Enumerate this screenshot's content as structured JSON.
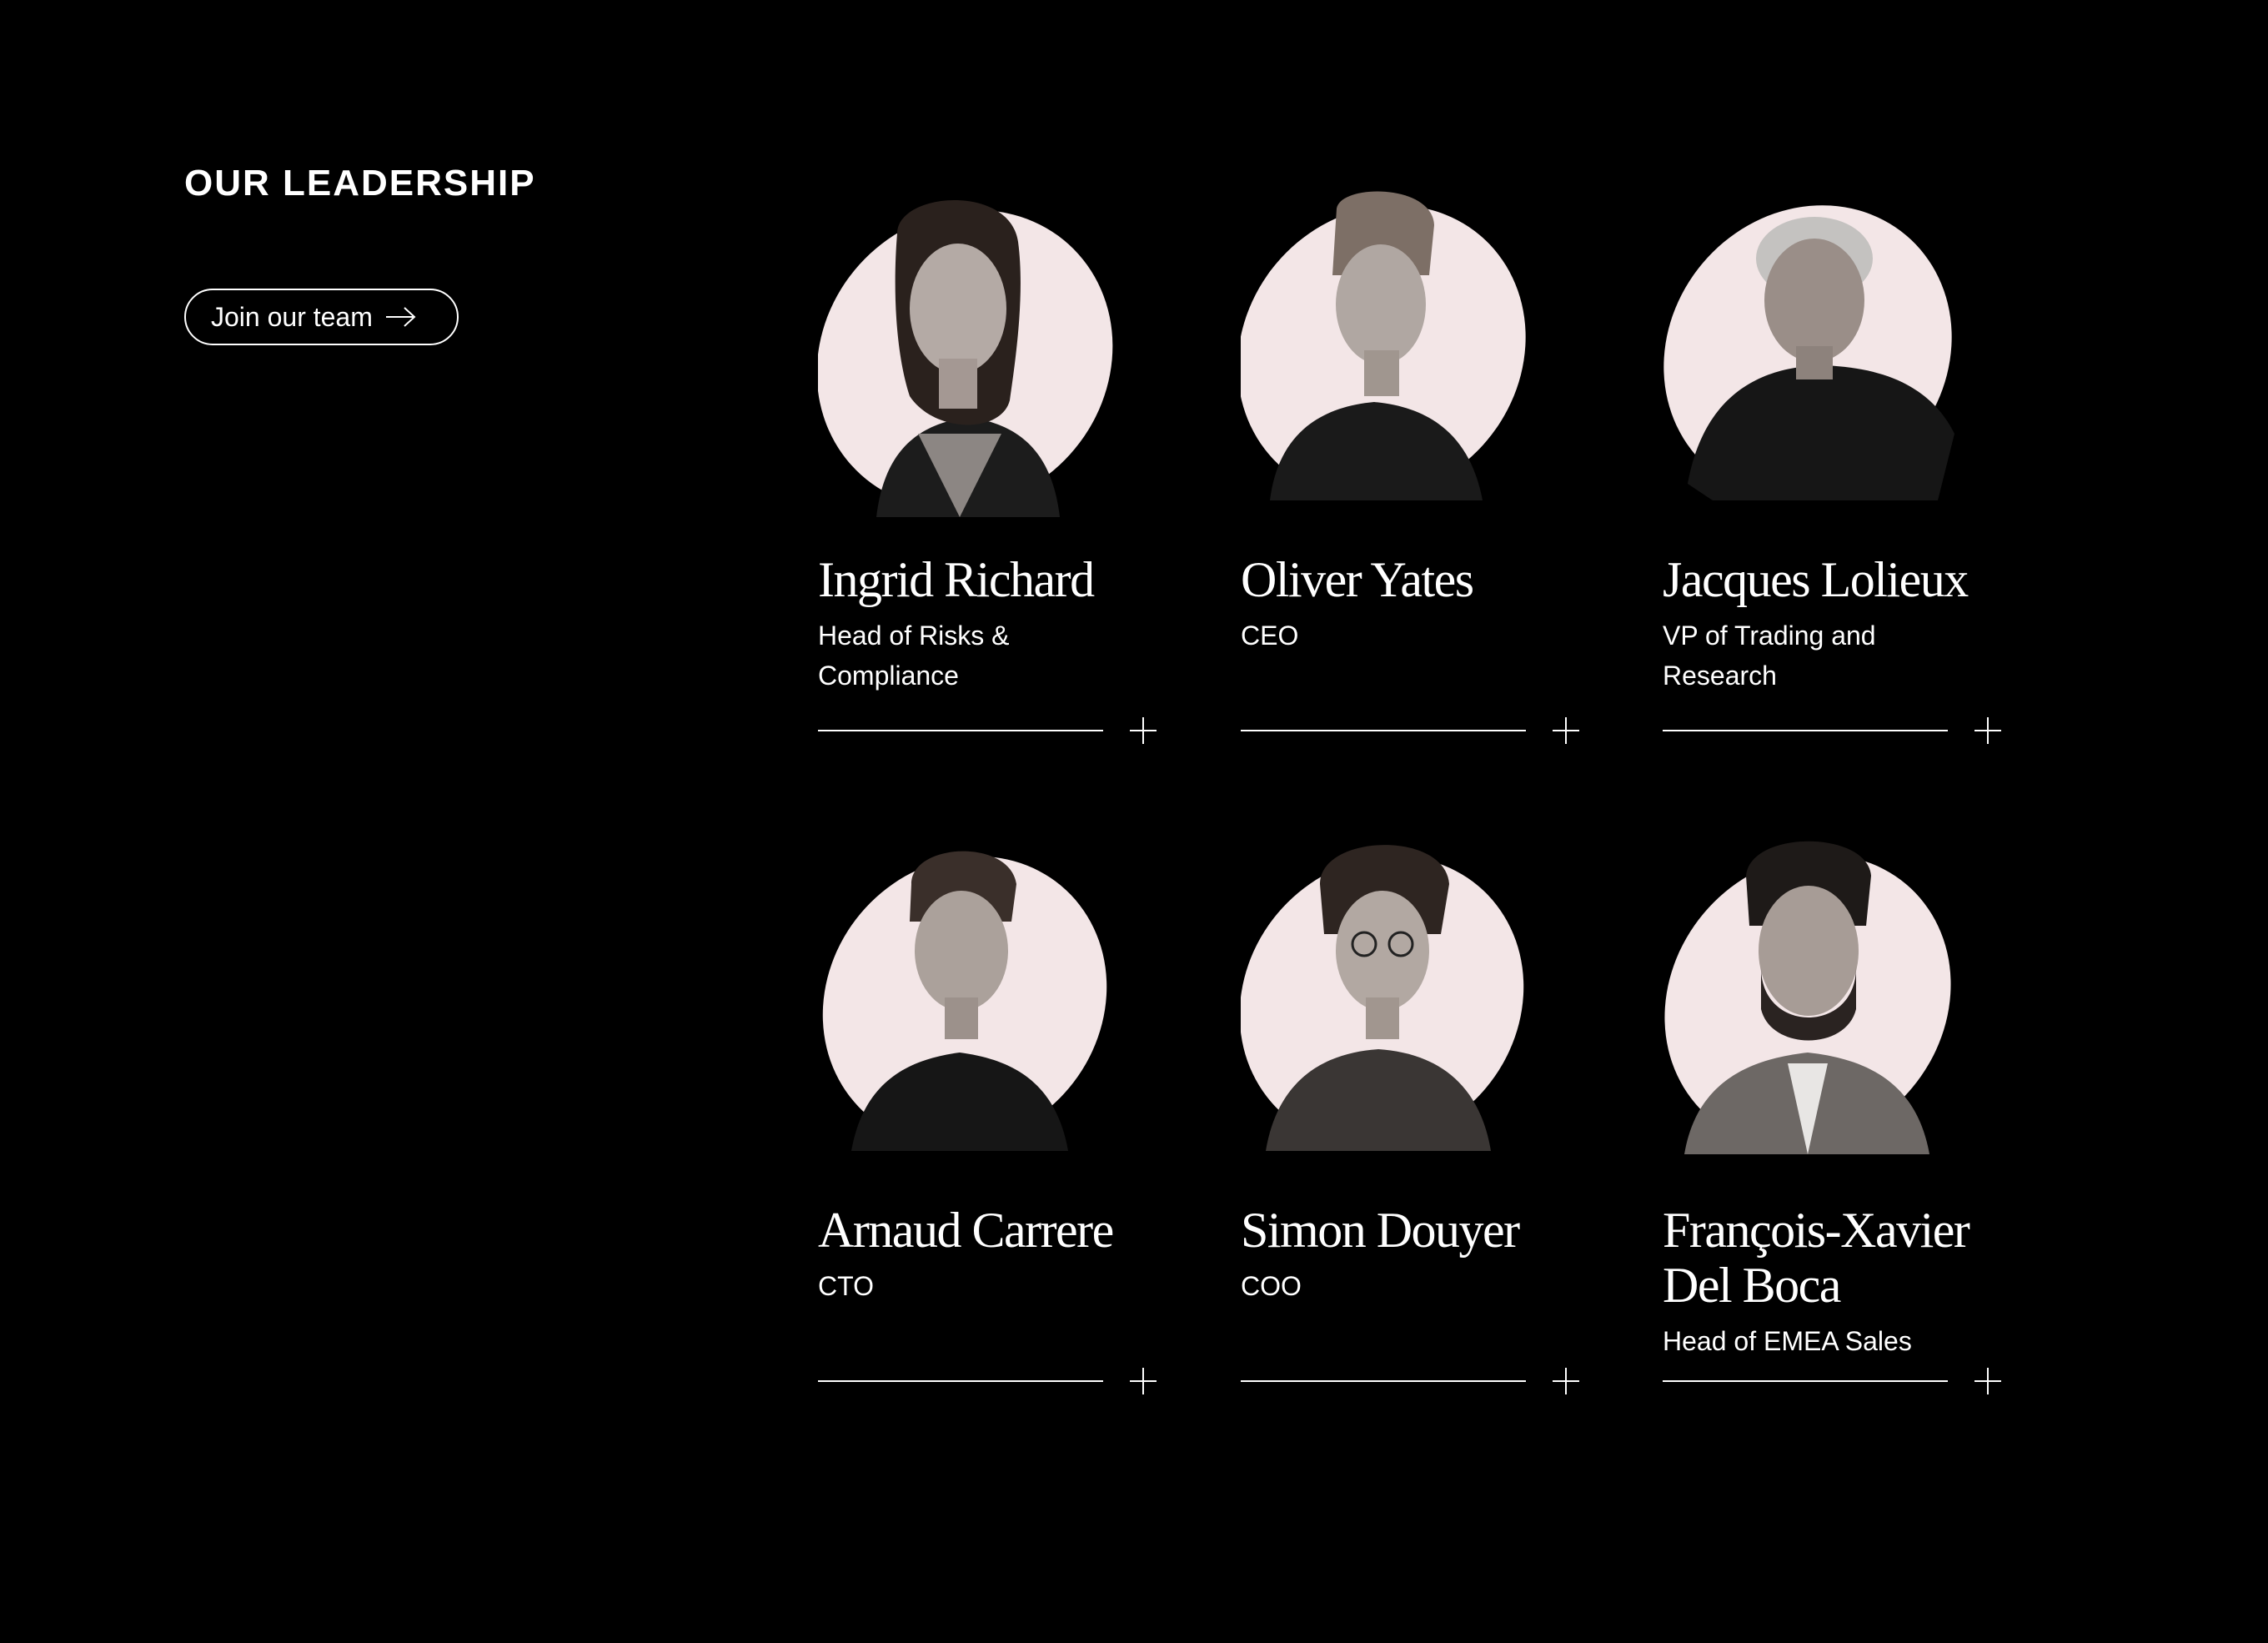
{
  "section": {
    "title": "OUR LEADERSHIP",
    "join_label": "Join our team"
  },
  "colors": {
    "background": "#000000",
    "text": "#ffffff",
    "portrait_blob": "#f3e6e7"
  },
  "icons": {
    "join_arrow": "arrow-right-icon",
    "expand": "plus-icon"
  },
  "leaders": [
    {
      "name": "Ingrid Richard",
      "role": "Head of Risks & Compliance"
    },
    {
      "name": "Oliver Yates",
      "role": "CEO"
    },
    {
      "name": "Jacques Lolieux",
      "role": "VP of Trading and Research"
    },
    {
      "name": "Arnaud Carrere",
      "role": "CTO"
    },
    {
      "name": "Simon Douyer",
      "role": "COO"
    },
    {
      "name": "François-Xavier Del Boca",
      "role": "Head of EMEA Sales"
    }
  ]
}
